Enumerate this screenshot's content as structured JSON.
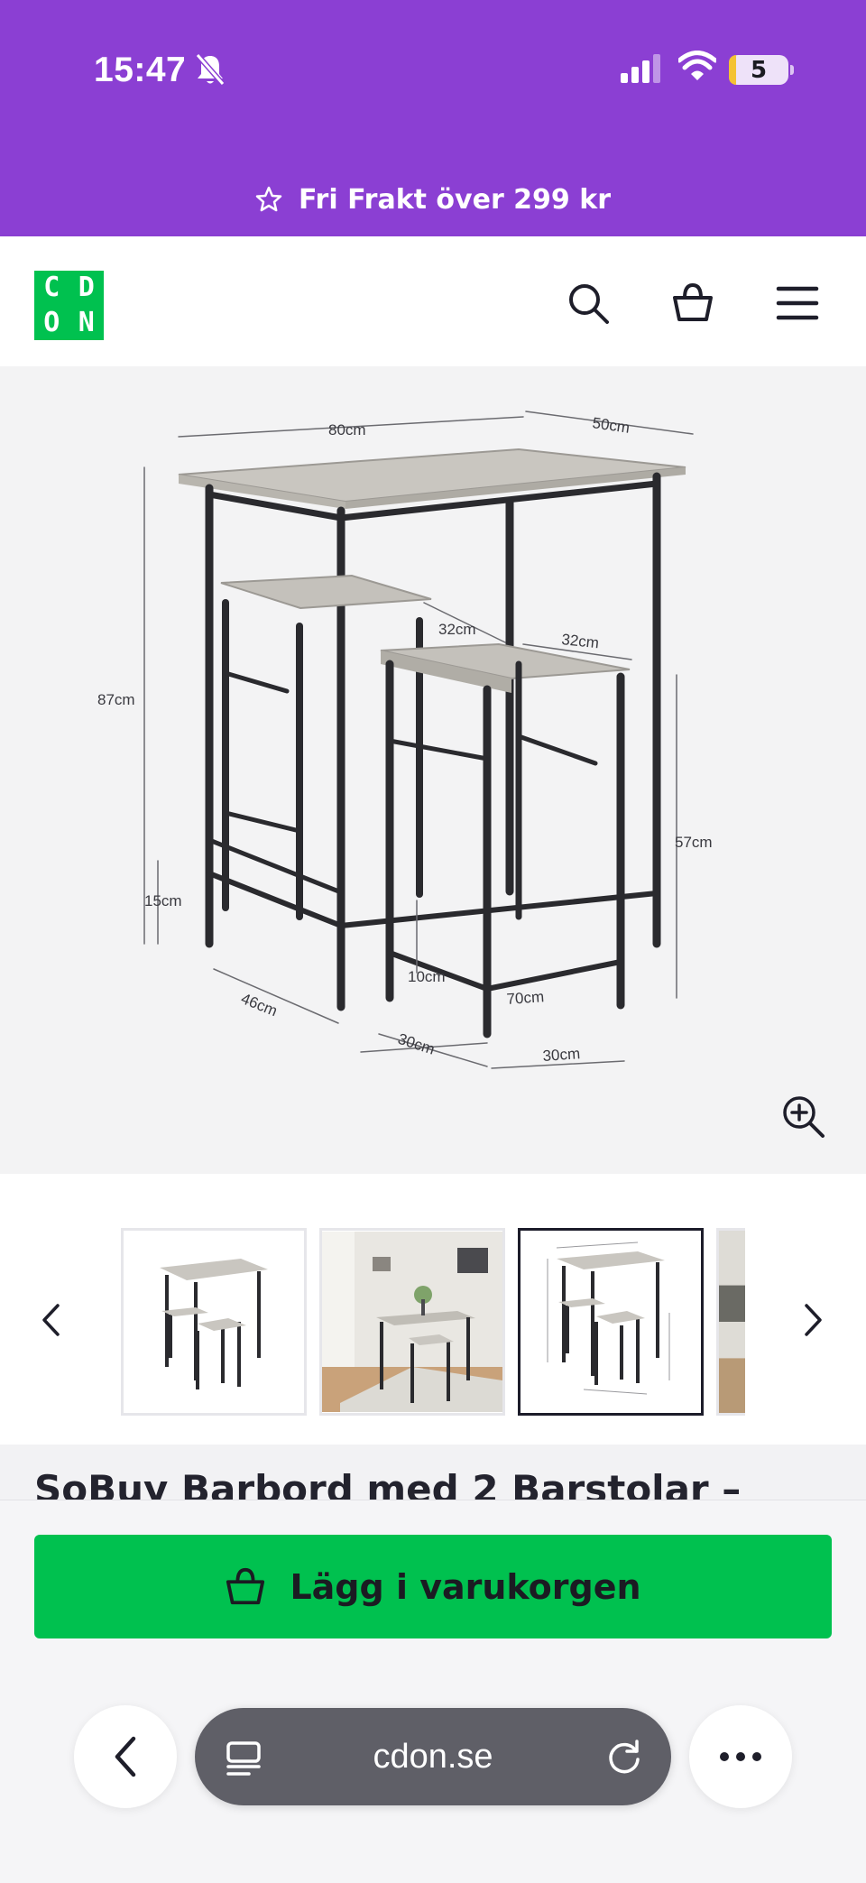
{
  "status": {
    "time": "15:47",
    "battery": "5"
  },
  "promo": {
    "text": "Fri Frakt över 299 kr",
    "icon": "star-outline-icon"
  },
  "header": {
    "logo_letters": [
      "C",
      "D",
      "O",
      "N"
    ],
    "icons": [
      "search-icon",
      "cart-icon",
      "menu-icon"
    ],
    "brand_color": "#00c14f",
    "accent_color": "#8b3fd3"
  },
  "gallery": {
    "dimensions": {
      "table_length": "80cm",
      "table_depth": "50cm",
      "table_height": "87cm",
      "foot_height": "15cm",
      "stool_width": "32cm",
      "stool_depth": "32cm",
      "stool_height": "57cm",
      "footrest_gap": "10cm",
      "table_base_length": "70cm",
      "base_depth": "46cm",
      "stool_base_1": "30cm",
      "stool_base_2": "30cm"
    },
    "zoom_icon": "zoom-in-icon",
    "thumbnails_count_visible": 4,
    "active_thumbnail": 3
  },
  "product": {
    "title": "SoBuy Barbord med 2 Barstolar –"
  },
  "actions": {
    "add_to_cart": "Lägg i varukorgen"
  },
  "browser": {
    "url": "cdon.se"
  }
}
